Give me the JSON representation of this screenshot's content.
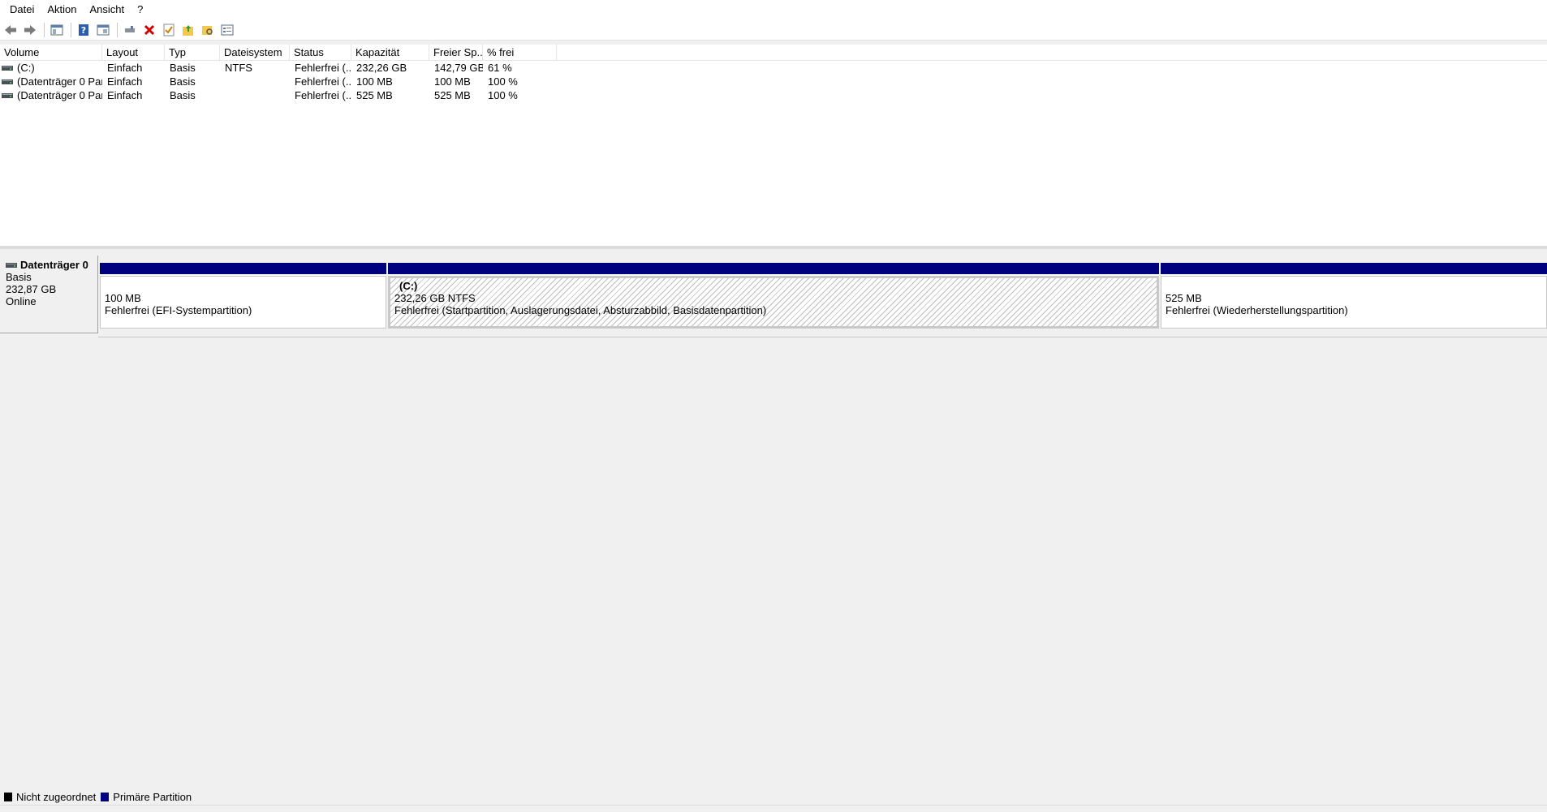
{
  "menu": [
    "Datei",
    "Aktion",
    "Ansicht",
    "?"
  ],
  "toolbar": {
    "icons": [
      "back-icon",
      "forward-icon",
      "console-tree-icon",
      "help-icon",
      "properties-icon",
      "connect-icon",
      "delete-icon",
      "check-icon",
      "folder-up-icon",
      "folder-search-icon",
      "view-list-icon"
    ]
  },
  "volume_table": {
    "columns": [
      "Volume",
      "Layout",
      "Typ",
      "Dateisystem",
      "Status",
      "Kapazität",
      "Freier Sp...",
      "% frei"
    ],
    "rows": [
      {
        "volume": "(C:)",
        "layout": "Einfach",
        "typ": "Basis",
        "fs": "NTFS",
        "status": "Fehlerfrei (...",
        "kap": "232,26 GB",
        "frei": "142,79 GB",
        "pct": "61 %"
      },
      {
        "volume": "(Datenträger 0 Par...",
        "layout": "Einfach",
        "typ": "Basis",
        "fs": "",
        "status": "Fehlerfrei (...",
        "kap": "100 MB",
        "frei": "100 MB",
        "pct": "100 %"
      },
      {
        "volume": "(Datenträger 0 Par...",
        "layout": "Einfach",
        "typ": "Basis",
        "fs": "",
        "status": "Fehlerfrei (...",
        "kap": "525 MB",
        "frei": "525 MB",
        "pct": "100 %"
      }
    ]
  },
  "disk": {
    "name": "Datenträger 0",
    "type": "Basis",
    "size": "232,87 GB",
    "state": "Online",
    "partitions": [
      {
        "name": "",
        "size": "100 MB",
        "status": "Fehlerfrei (EFI-Systempartition)"
      },
      {
        "name": "(C:)",
        "size": "232,26 GB NTFS",
        "status": "Fehlerfrei (Startpartition, Auslagerungsdatei, Absturzabbild, Basisdatenpartition)"
      },
      {
        "name": "",
        "size": "525 MB",
        "status": "Fehlerfrei (Wiederherstellungspartition)"
      }
    ]
  },
  "legend": [
    {
      "label": "Nicht zugeordnet",
      "color": "#000000"
    },
    {
      "label": "Primäre Partition",
      "color": "#00007f"
    }
  ],
  "colors": {
    "primary_partition": "#00007f",
    "unallocated": "#000000"
  }
}
